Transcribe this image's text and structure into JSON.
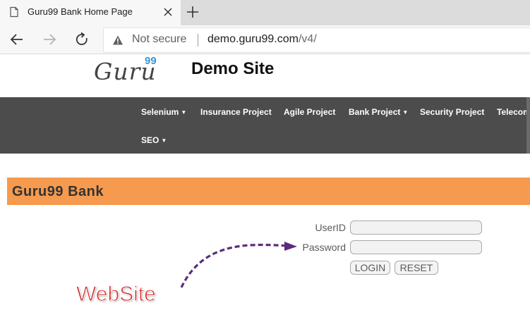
{
  "browser": {
    "tab_title": "Guru99 Bank Home Page",
    "security_status": "Not secure",
    "url_host": "demo.guru99.com",
    "url_path": "/v4/",
    "icons": [
      "page-icon",
      "close-icon",
      "plus-icon",
      "back-arrow-icon",
      "forward-arrow-icon",
      "reload-icon",
      "warning-icon"
    ]
  },
  "site": {
    "logo_text": "Guru",
    "logo_superscript": "99",
    "title": "Demo Site"
  },
  "nav": {
    "items": [
      {
        "label": "Selenium",
        "caret": "▼"
      },
      {
        "label": "Insurance Project"
      },
      {
        "label": "Agile Project"
      },
      {
        "label": "Bank Project",
        "caret": "▼"
      },
      {
        "label": "Security Project"
      },
      {
        "label": "Telecom"
      },
      {
        "label": "SEO",
        "caret": "▼"
      }
    ]
  },
  "bank": {
    "title": "Guru99 Bank"
  },
  "login": {
    "userid_label": "UserID",
    "password_label": "Password",
    "login_button": "LOGIN",
    "reset_button": "RESET"
  },
  "annotation": {
    "text": "WebSite",
    "color": "#d42a2a",
    "arrow_color": "#5b2d7a"
  },
  "colors": {
    "navbar": "#4c4c4c",
    "banner": "#f59a4e"
  }
}
